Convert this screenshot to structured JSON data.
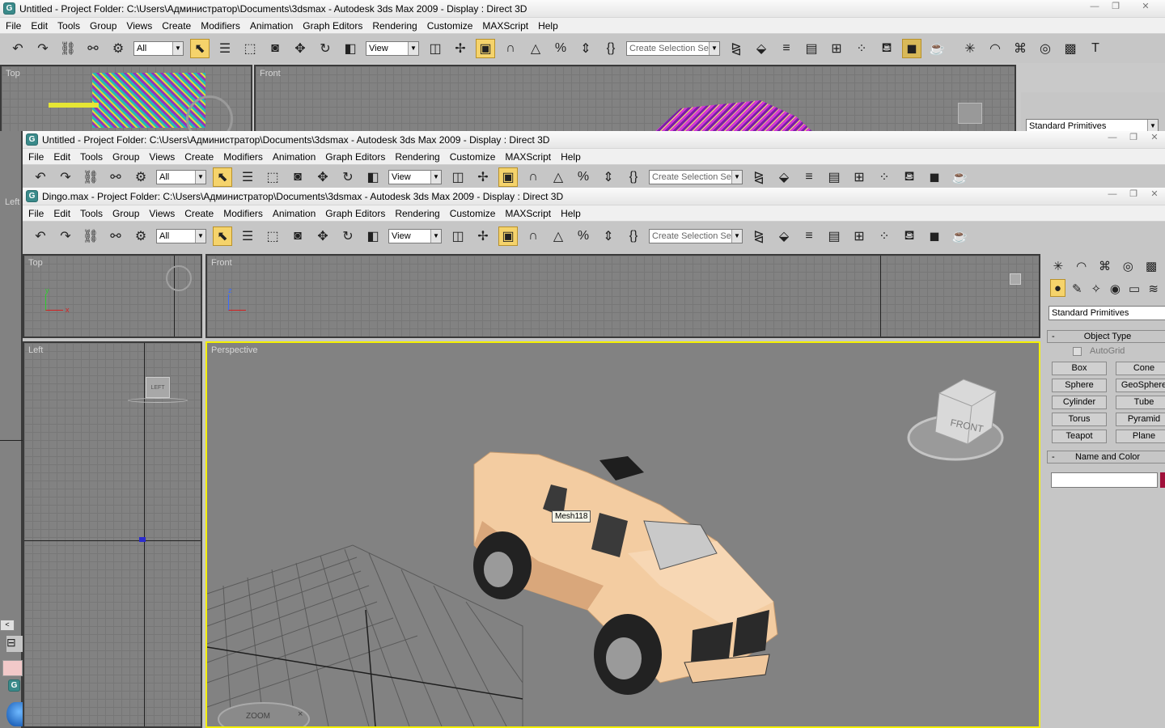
{
  "back_window": {
    "title": "Untitled     - Project Folder: C:\\Users\\Администратор\\Documents\\3dsmax     - Autodesk 3ds Max  2009     - Display : Direct 3D",
    "viewports": {
      "top": "Top",
      "front": "Front"
    },
    "panel_dropdown": "Standard Primitives"
  },
  "middle_window": {
    "title": "Untitled     - Project Folder: C:\\Users\\Администратор\\Documents\\3dsmax     - Autodesk 3ds Max  2009     - Display : Direct 3D",
    "left_label": "Left"
  },
  "front_window": {
    "title": "Dingo.max     - Project Folder: C:\\Users\\Администратор\\Documents\\3dsmax     - Autodesk 3ds Max  2009     - Display : Direct 3D",
    "viewports": {
      "top": "Top",
      "front": "Front",
      "left": "Left",
      "perspective": "Perspective"
    },
    "viewcube_left": "LEFT",
    "viewcube_front": "FRONT",
    "zoom_label": "ZOOM",
    "object_tooltip": "Mesh118",
    "axis_y": "y",
    "axis_x": "x",
    "axis_z": "z"
  },
  "menus": [
    "File",
    "Edit",
    "Tools",
    "Group",
    "Views",
    "Create",
    "Modifiers",
    "Animation",
    "Graph Editors",
    "Rendering",
    "Customize",
    "MAXScript",
    "Help"
  ],
  "toolbar": {
    "selection_filter": "All",
    "ref_coord": "View",
    "named_selection_placeholder": "Create Selection Set"
  },
  "command_panel": {
    "category_dropdown": "Standard Primitives",
    "object_type_header": "Object Type",
    "autogrid_label": "AutoGrid",
    "primitive_buttons": [
      "Box",
      "Cone",
      "Sphere",
      "GeoSphere",
      "Cylinder",
      "Tube",
      "Torus",
      "Pyramid",
      "Teapot",
      "Plane"
    ],
    "name_color_header": "Name and Color",
    "name_value": "",
    "object_color": "#a0103a"
  },
  "window_controls": {
    "minimize": "—",
    "maximize": "❐",
    "close": "✕"
  },
  "colors": {
    "active_viewport_border": "#f4f000",
    "selected_tool": "#f5d36b",
    "vehicle_body": "#f3cca1"
  }
}
